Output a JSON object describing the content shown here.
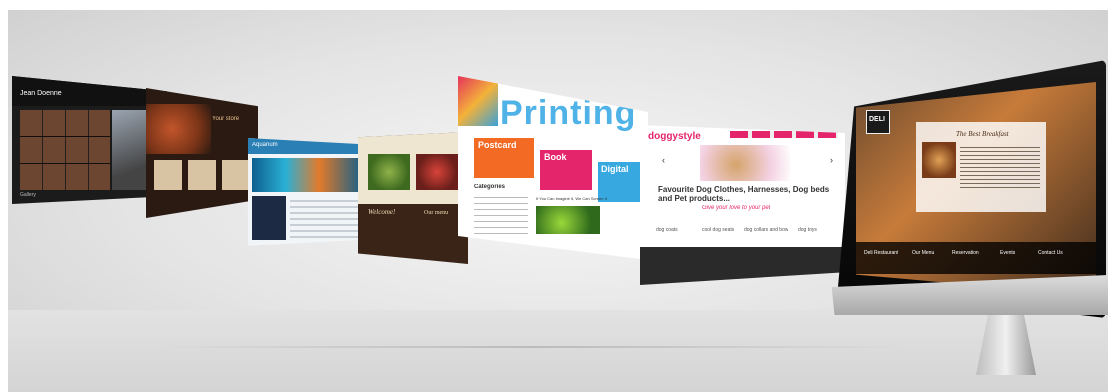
{
  "panel1": {
    "logo": "Jean Doenne",
    "caption": "Gallery"
  },
  "panel2": {
    "title": "Your store"
  },
  "panel3": {
    "brand": "Aquarium"
  },
  "panel4": {
    "welcome": "Welcome!",
    "title": "Our menu"
  },
  "panel5": {
    "headline": "Printing",
    "tiles": [
      "Postcard",
      "Book",
      "Digital"
    ],
    "side_title": "Categories",
    "body": "If You Can Imagine It, We Can Screen It"
  },
  "panel6": {
    "brand": "doggystyle",
    "headline": "Favourite Dog Clothes, Harnesses, Dog beds and Pet products...",
    "tagline": "Give your love to your pet",
    "items": [
      "dog coats",
      "cool dog seats",
      "dog collars and bowls",
      "dog toys"
    ]
  },
  "monitor": {
    "logo": "DELI",
    "heading": "The Best Breakfast",
    "nav": [
      "Deli Restaurant",
      "Our Menu",
      "Reservation",
      "Events",
      "Contact Us"
    ]
  }
}
